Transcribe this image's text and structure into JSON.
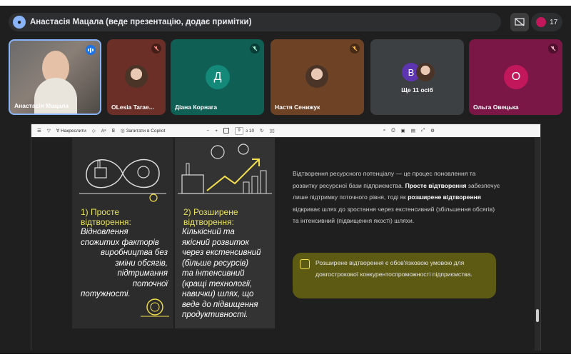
{
  "header": {
    "title": "Анастасія Мацала (веде презентацію, додає примітки)",
    "participant_count": "17"
  },
  "tiles": [
    {
      "name": "Анастасія Мацала"
    },
    {
      "name": "OLesia Tarae..."
    },
    {
      "name": "Діана Корнага",
      "initial": "Д"
    },
    {
      "name": "Настя Сенижук"
    },
    {
      "name": "Ще 11 осіб",
      "initial": "В"
    },
    {
      "name": "Ольга Овецька",
      "initial": "О"
    }
  ],
  "toolbar": {
    "draw_label": "Накреслити",
    "copilot_label": "Запитати в Copilot",
    "page_current": "9",
    "page_total": "з 10"
  },
  "slide": {
    "left_title": [
      "1) Просте",
      "відтворення:"
    ],
    "left_body": [
      "Відновлення",
      "спожитих факторів",
      "виробництва без",
      "зміни обсягів,",
      "підтримання",
      "поточної",
      "потужності."
    ],
    "right_title": [
      "2) Розширене",
      "відтворення:"
    ],
    "right_body": [
      "Кількісний та",
      "якісний розвиток",
      "через екстенсивний",
      "(більше ресурсів)",
      "та інтенсивний",
      "(кращі технології,",
      "навички) шлях, що",
      "веде до підвищення",
      "продуктивності."
    ],
    "para_1": "Відтворення ресурсного потенціалу — це процес поновлення та розвитку ресурсної бази підприємства.",
    "para_b1": "Просте відтворення",
    "para_2": "забезпечує лише підтримку поточного рівня, тоді як",
    "para_b2": "розширене відтворення",
    "para_3": "відкриває шлях до зростання через екстенсивний (збільшення обсягів) та інтенсивний (підвищення якості) шляхи.",
    "callout": "Розширене відтворення є обов'язковою умовою для довгострокової конкурентоспроможності підприємства."
  }
}
